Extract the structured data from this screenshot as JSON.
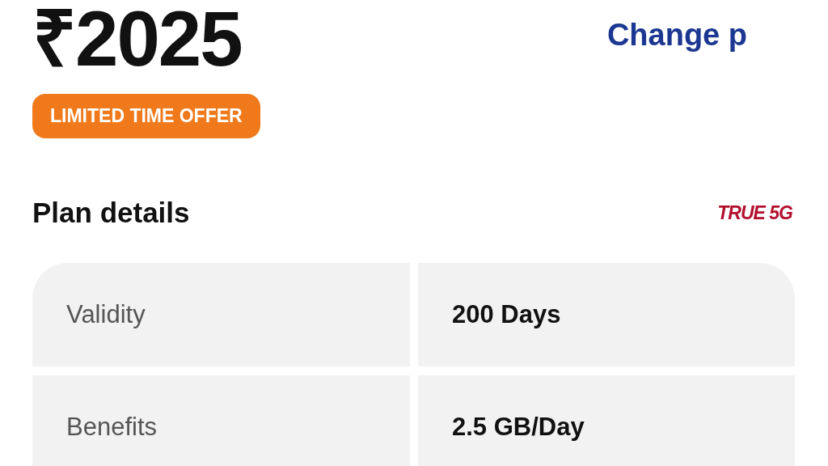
{
  "price": "₹2025",
  "change_link": "Change p",
  "offer_badge": "LIMITED TIME OFFER",
  "section_title": "Plan details",
  "network_badge": "TRUE 5G",
  "details": [
    {
      "label": "Validity",
      "value": "200 Days"
    },
    {
      "label": "Benefits",
      "value": "2.5 GB/Day"
    }
  ]
}
